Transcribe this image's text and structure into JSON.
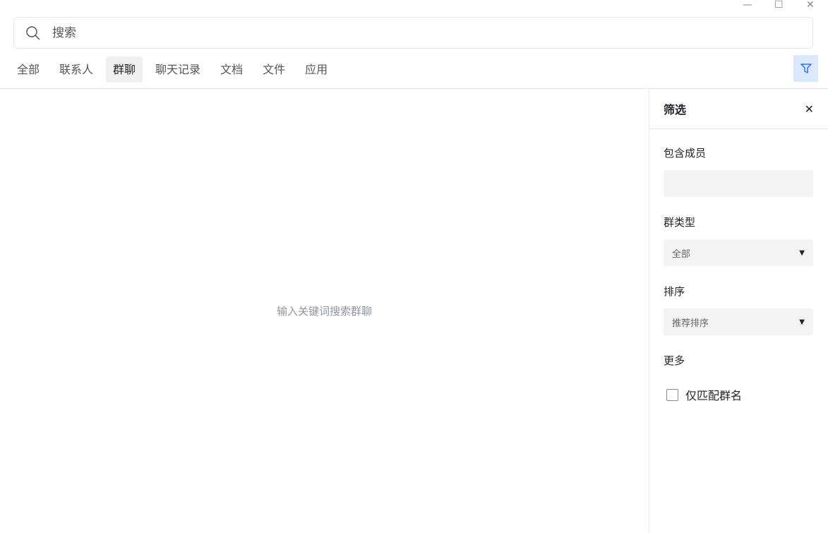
{
  "window": {
    "minimize": "—",
    "maximize": "☐",
    "close": "✕"
  },
  "search": {
    "placeholder": "搜索"
  },
  "tabs": [
    {
      "label": "全部"
    },
    {
      "label": "联系人"
    },
    {
      "label": "群聊"
    },
    {
      "label": "聊天记录"
    },
    {
      "label": "文档"
    },
    {
      "label": "文件"
    },
    {
      "label": "应用"
    }
  ],
  "active_tab": "群聊",
  "empty_text": "输入关键词搜索群聊",
  "filter": {
    "title": "筛选",
    "close": "✕",
    "members_label": "包含成员",
    "group_type_label": "群类型",
    "group_type_value": "全部",
    "sort_label": "排序",
    "sort_value": "推荐排序",
    "more_label": "更多",
    "match_name_label": "仅匹配群名",
    "match_name_checked": false
  },
  "colors": {
    "accent": "#3370ff",
    "filter_btn_bg": "#dce8fb"
  }
}
